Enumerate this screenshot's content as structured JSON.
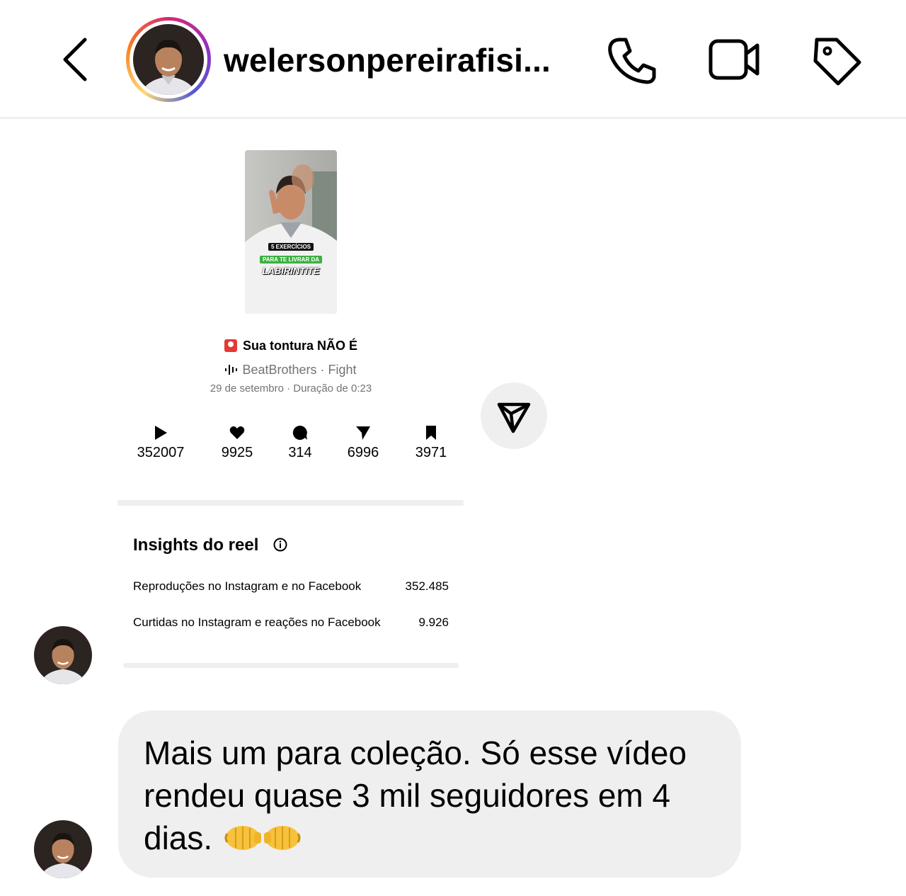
{
  "header": {
    "username": "welersonpereirafisi...",
    "icons": [
      "back-chevron-icon",
      "phone-icon",
      "video-call-icon",
      "tag-icon"
    ]
  },
  "reel": {
    "thumbnail_caption": {
      "line1": "5 EXERCÍCIOS",
      "line2": "PARA TE LIVRAR DA",
      "line3": "LABIRINTITE"
    },
    "title": "Sua tontura NÃO É",
    "music": "BeatBrothers · Fight",
    "date": "29 de setembro · Duração de 0:23",
    "stats": {
      "plays": "352007",
      "likes": "9925",
      "comments": "314",
      "shares": "6996",
      "saves": "3971"
    }
  },
  "insights": {
    "title": "Insights do reel",
    "rows": [
      {
        "label": "Reproduções no Instagram e no Facebook",
        "value": "352.485"
      },
      {
        "label": "Curtidas no Instagram e reações no Facebook",
        "value": "9.926"
      }
    ]
  },
  "message": {
    "text": "Mais um para coleção. Só esse vídeo rendeu quase 3 mil seguidores em 4 dias.",
    "emojis": [
      "left-facing-fist-icon",
      "right-facing-fist-icon"
    ]
  },
  "colors": {
    "bubble": "#efefef",
    "secondary_text": "#737373",
    "divider": "#dbdbdb",
    "accent_green": "#3cb043"
  }
}
